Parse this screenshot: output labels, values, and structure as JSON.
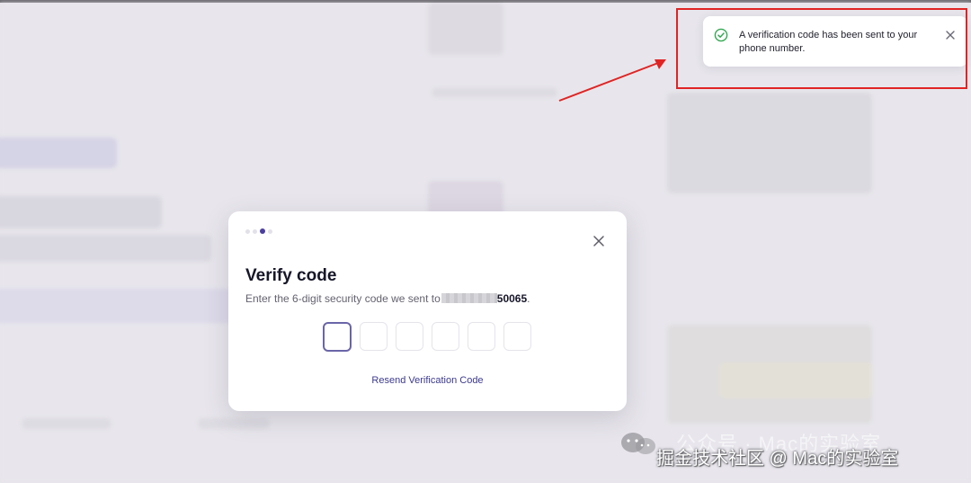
{
  "modal": {
    "title": "Verify code",
    "description_prefix": "Enter the 6-digit security code we sent to",
    "phone_suffix": "50065",
    "description_end": ".",
    "code_boxes": [
      "",
      "",
      "",
      "",
      "",
      ""
    ],
    "resend_label": "Resend Verification Code",
    "steps": {
      "total": 3,
      "current": 3
    },
    "close_icon": "close-icon"
  },
  "toast": {
    "message": "A verification code has been sent to your phone number.",
    "status_icon": "check-circle-icon",
    "close_icon": "close-icon",
    "colors": {
      "success": "#34a853"
    }
  },
  "annotation": {
    "color": "#e02424"
  },
  "watermark": {
    "line1": "公众号 · Mac的实验室",
    "line2": "掘金技术社区 @ Mac的实验室"
  },
  "colors": {
    "accent": "#4b3f9e",
    "link": "#3c3a8e",
    "title": "#161629"
  }
}
